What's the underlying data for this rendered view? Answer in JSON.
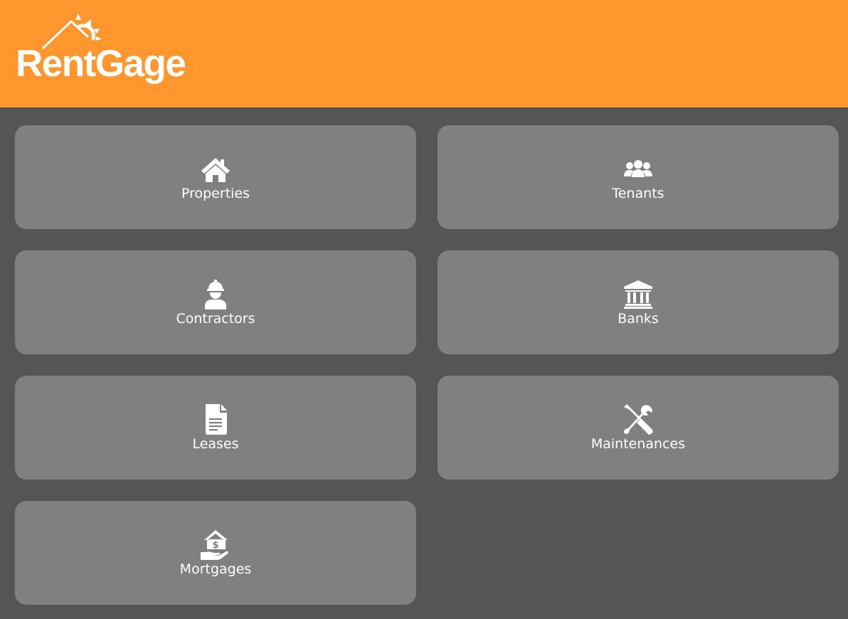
{
  "app": {
    "logo_text": "RentGage",
    "header_color": "#ff962e",
    "background_color": "#555555",
    "tile_color": "#808080"
  },
  "tiles": [
    {
      "label": "Properties",
      "icon": "house-icon"
    },
    {
      "label": "Tenants",
      "icon": "users-icon"
    },
    {
      "label": "Contractors",
      "icon": "hard-hat-worker-icon"
    },
    {
      "label": "Banks",
      "icon": "bank-building-icon"
    },
    {
      "label": "Leases",
      "icon": "document-icon"
    },
    {
      "label": "Maintenances",
      "icon": "tools-icon"
    },
    {
      "label": "Mortgages",
      "icon": "hand-house-dollar-icon"
    }
  ]
}
